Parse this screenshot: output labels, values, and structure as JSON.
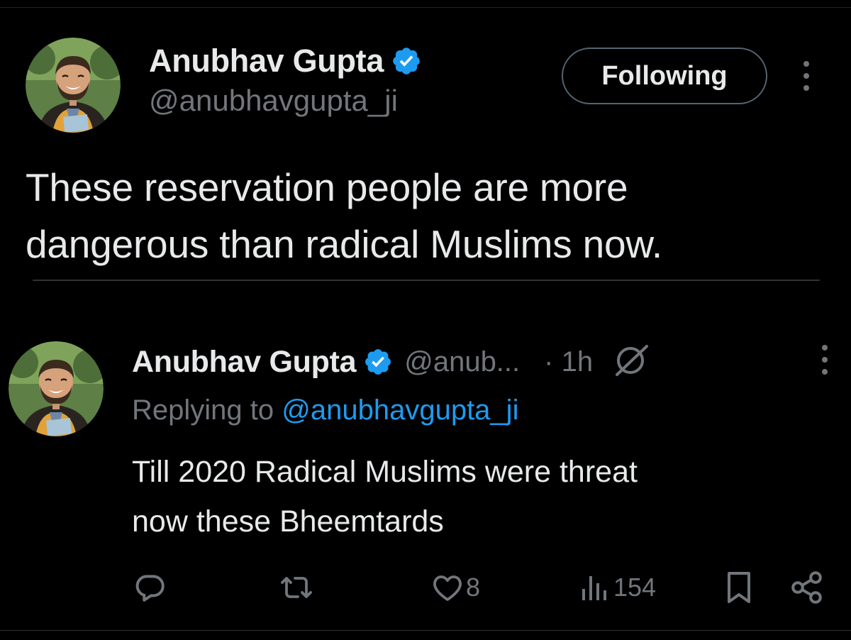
{
  "tweet": {
    "author_name": "Anubhav Gupta",
    "author_handle": "@anubhavgupta_ji",
    "follow_label": "Following",
    "text_line1": "These reservation people are more",
    "text_line2": "dangerous than radical Muslims now."
  },
  "reply": {
    "author_name": "Anubhav Gupta",
    "author_handle": "@anub...",
    "time": "· 1h",
    "replying_prefix": "Replying to",
    "replying_handle": "@anubhavgupta_ji",
    "text_line1": "Till 2020 Radical Muslims were threat",
    "text_line2": "now these Bheemtards",
    "actions": {
      "reply_count": "",
      "retweet_count": "",
      "like_count": "8",
      "view_count": "154"
    }
  },
  "icons": {
    "verified": "verified-badge-icon",
    "more": "more-vertical-icon",
    "grok": "grok-icon",
    "reply": "reply-icon",
    "retweet": "retweet-icon",
    "like": "heart-icon",
    "views": "views-icon",
    "bookmark": "bookmark-icon",
    "share": "share-icon"
  },
  "colors": {
    "background": "#000000",
    "text": "#e7e9ea",
    "secondary": "#71767b",
    "accent": "#1d9bf0"
  }
}
